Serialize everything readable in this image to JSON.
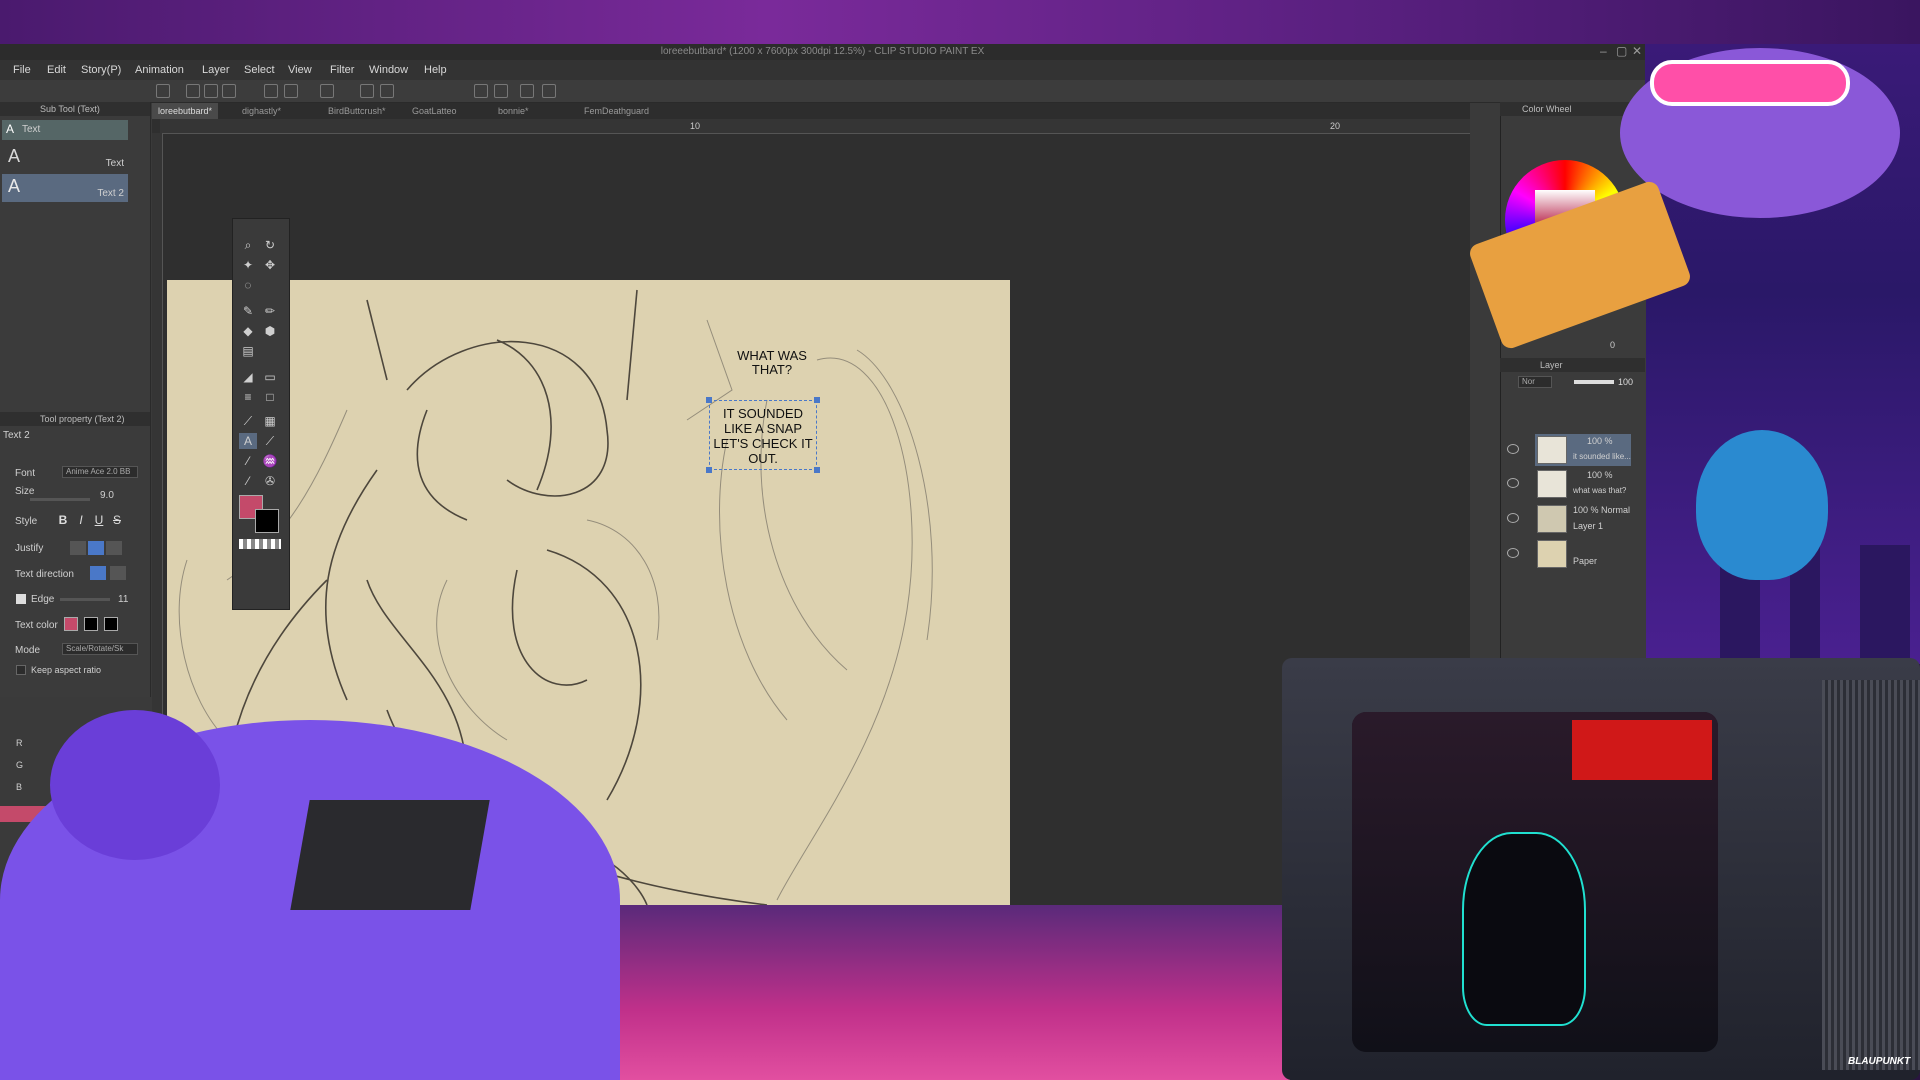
{
  "window": {
    "title": "loreeebutbard* (1200 x 7600px 300dpi 12.5%) - CLIP STUDIO PAINT EX",
    "controls": [
      "–",
      "▢",
      "✕"
    ]
  },
  "menu": [
    "File",
    "Edit",
    "Story(P)",
    "Animation",
    "Layer",
    "Select",
    "View",
    "Filter",
    "Window",
    "Help"
  ],
  "tabs": [
    {
      "label": "loreebutbard*",
      "active": true
    },
    {
      "label": "dighastly*",
      "active": false
    },
    {
      "label": "BirdButtcrush*",
      "active": false
    },
    {
      "label": "GoatLatteo",
      "active": false
    },
    {
      "label": "bonnie*",
      "active": false
    },
    {
      "label": "FemDeathguard",
      "active": false
    }
  ],
  "ruler": {
    "mark1": "10",
    "mark2": "20"
  },
  "subtool": {
    "header": "Sub Tool (Text)",
    "group": "Text",
    "items": [
      {
        "label": "Text",
        "active": false
      },
      {
        "label": "Text 2",
        "active": true
      }
    ]
  },
  "toolprop": {
    "header": "Tool property (Text 2)",
    "name": "Text 2",
    "font_label": "Font",
    "font_value": "Anime Ace 2.0 BB",
    "size_label": "Size",
    "size_value": "9.0",
    "style_label": "Style",
    "style_buttons": [
      "B",
      "I",
      "U",
      "S"
    ],
    "justify_label": "Justify",
    "direction_label": "Text direction",
    "edge_label": "Edge",
    "edge_value": "11",
    "textcolor_label": "Text color",
    "mode_label": "Mode",
    "mode_value": "Scale/Rotate/Sk",
    "aspect_label": "Keep aspect ratio"
  },
  "colorsliders": {
    "r": "R",
    "g": "G",
    "b": "B"
  },
  "canvas": {
    "bubble1": "WHAT WAS THAT?",
    "bubble2": "IT SOUNDED LIKE A SNAP LET'S CHECK IT OUT."
  },
  "colorwheel": {
    "header": "Color Wheel",
    "value": "0"
  },
  "layers": {
    "header": "Layer",
    "blend": "Nor",
    "opacity": "100",
    "rows": [
      {
        "top": "100 %",
        "name": "it sounded like..."
      },
      {
        "top": "100 %",
        "name": "what was that?"
      },
      {
        "top": "100 % Normal",
        "name": "Layer 1"
      },
      {
        "top": "",
        "name": "Paper"
      }
    ]
  },
  "tv": {
    "brand": "BLAUPUNKT"
  },
  "colors": {
    "accent": "#c44a6a",
    "primary": "#c44a6a",
    "secondary": "#000000",
    "selection": "#4a78c8"
  }
}
